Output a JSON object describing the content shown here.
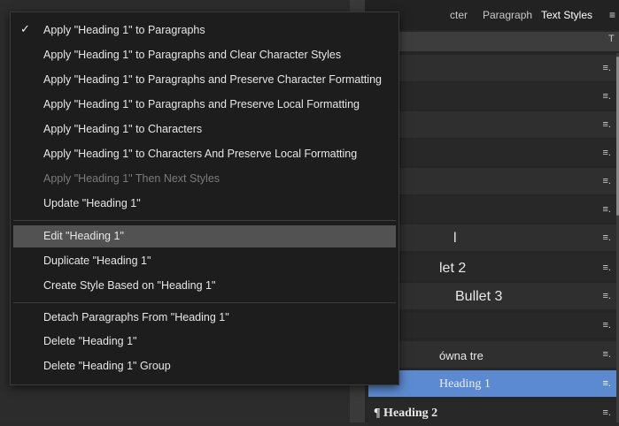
{
  "panel": {
    "tabs": [
      {
        "label": "cter"
      },
      {
        "label": "Paragraph"
      },
      {
        "label": "Text Styles"
      }
    ],
    "menu_icon": "hamburger-icon",
    "search_icon": "text-search-icon",
    "styles": [
      {
        "label": "",
        "icon": "list-icon"
      },
      {
        "label": "",
        "icon": "list-icon"
      },
      {
        "label": "",
        "icon": "list-icon"
      },
      {
        "label": "",
        "icon": "list-icon"
      },
      {
        "label": "",
        "icon": "list-icon"
      },
      {
        "label": "",
        "icon": "list-icon"
      },
      {
        "label": "l",
        "icon": "list-icon"
      },
      {
        "label": "let 2",
        "icon": "list-icon"
      },
      {
        "label": "Bullet 3",
        "icon": "list-icon"
      },
      {
        "label": "",
        "icon": "list-icon"
      },
      {
        "label": "ówna tre",
        "icon": "list-icon"
      },
      {
        "label": "Heading 1",
        "icon": "list-icon"
      },
      {
        "label": "¶ Heading 2",
        "icon": "list-icon"
      }
    ]
  },
  "context_menu": {
    "items": [
      {
        "label": "Apply \"Heading 1\" to Paragraphs",
        "checked": "✓"
      },
      {
        "label": "Apply \"Heading 1\" to Paragraphs and Clear Character Styles"
      },
      {
        "label": "Apply \"Heading 1\" to Paragraphs and Preserve Character Formatting"
      },
      {
        "label": "Apply \"Heading 1\" to Paragraphs and Preserve Local Formatting"
      },
      {
        "label": "Apply \"Heading 1\" to Characters"
      },
      {
        "label": "Apply \"Heading 1\" to Characters And Preserve Local Formatting"
      },
      {
        "label": "Apply \"Heading 1\" Then Next Styles",
        "disabled": true
      },
      {
        "label": "Update \"Heading 1\""
      },
      {
        "label": "Edit \"Heading 1\"",
        "highlighted": true
      },
      {
        "label": "Duplicate \"Heading 1\""
      },
      {
        "label": "Create Style Based on \"Heading 1\""
      },
      {
        "label": "Detach Paragraphs From \"Heading 1\""
      },
      {
        "label": "Delete \"Heading 1\""
      },
      {
        "label": "Delete \"Heading 1\" Group"
      }
    ]
  },
  "colors": {
    "menu_bg": "#1d1d1d",
    "highlight": "#525252",
    "selected_style": "#5b8ad0"
  }
}
